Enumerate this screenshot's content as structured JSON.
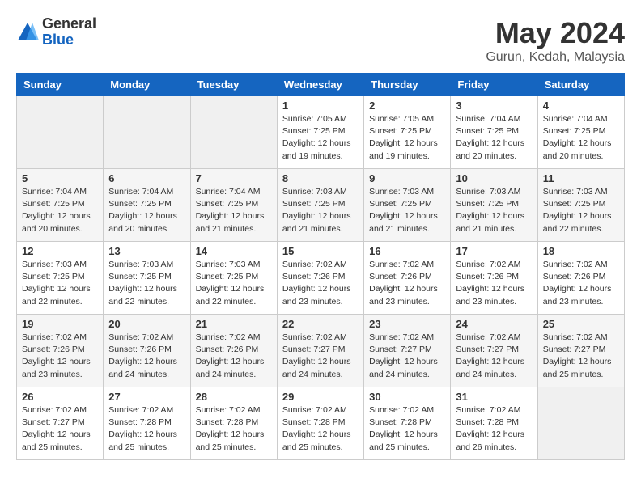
{
  "header": {
    "logo_general": "General",
    "logo_blue": "Blue",
    "month_title": "May 2024",
    "subtitle": "Gurun, Kedah, Malaysia"
  },
  "days_of_week": [
    "Sunday",
    "Monday",
    "Tuesday",
    "Wednesday",
    "Thursday",
    "Friday",
    "Saturday"
  ],
  "weeks": [
    [
      {
        "day": "",
        "info": ""
      },
      {
        "day": "",
        "info": ""
      },
      {
        "day": "",
        "info": ""
      },
      {
        "day": "1",
        "info": "Sunrise: 7:05 AM\nSunset: 7:25 PM\nDaylight: 12 hours\nand 19 minutes."
      },
      {
        "day": "2",
        "info": "Sunrise: 7:05 AM\nSunset: 7:25 PM\nDaylight: 12 hours\nand 19 minutes."
      },
      {
        "day": "3",
        "info": "Sunrise: 7:04 AM\nSunset: 7:25 PM\nDaylight: 12 hours\nand 20 minutes."
      },
      {
        "day": "4",
        "info": "Sunrise: 7:04 AM\nSunset: 7:25 PM\nDaylight: 12 hours\nand 20 minutes."
      }
    ],
    [
      {
        "day": "5",
        "info": "Sunrise: 7:04 AM\nSunset: 7:25 PM\nDaylight: 12 hours\nand 20 minutes."
      },
      {
        "day": "6",
        "info": "Sunrise: 7:04 AM\nSunset: 7:25 PM\nDaylight: 12 hours\nand 20 minutes."
      },
      {
        "day": "7",
        "info": "Sunrise: 7:04 AM\nSunset: 7:25 PM\nDaylight: 12 hours\nand 21 minutes."
      },
      {
        "day": "8",
        "info": "Sunrise: 7:03 AM\nSunset: 7:25 PM\nDaylight: 12 hours\nand 21 minutes."
      },
      {
        "day": "9",
        "info": "Sunrise: 7:03 AM\nSunset: 7:25 PM\nDaylight: 12 hours\nand 21 minutes."
      },
      {
        "day": "10",
        "info": "Sunrise: 7:03 AM\nSunset: 7:25 PM\nDaylight: 12 hours\nand 21 minutes."
      },
      {
        "day": "11",
        "info": "Sunrise: 7:03 AM\nSunset: 7:25 PM\nDaylight: 12 hours\nand 22 minutes."
      }
    ],
    [
      {
        "day": "12",
        "info": "Sunrise: 7:03 AM\nSunset: 7:25 PM\nDaylight: 12 hours\nand 22 minutes."
      },
      {
        "day": "13",
        "info": "Sunrise: 7:03 AM\nSunset: 7:25 PM\nDaylight: 12 hours\nand 22 minutes."
      },
      {
        "day": "14",
        "info": "Sunrise: 7:03 AM\nSunset: 7:25 PM\nDaylight: 12 hours\nand 22 minutes."
      },
      {
        "day": "15",
        "info": "Sunrise: 7:02 AM\nSunset: 7:26 PM\nDaylight: 12 hours\nand 23 minutes."
      },
      {
        "day": "16",
        "info": "Sunrise: 7:02 AM\nSunset: 7:26 PM\nDaylight: 12 hours\nand 23 minutes."
      },
      {
        "day": "17",
        "info": "Sunrise: 7:02 AM\nSunset: 7:26 PM\nDaylight: 12 hours\nand 23 minutes."
      },
      {
        "day": "18",
        "info": "Sunrise: 7:02 AM\nSunset: 7:26 PM\nDaylight: 12 hours\nand 23 minutes."
      }
    ],
    [
      {
        "day": "19",
        "info": "Sunrise: 7:02 AM\nSunset: 7:26 PM\nDaylight: 12 hours\nand 23 minutes."
      },
      {
        "day": "20",
        "info": "Sunrise: 7:02 AM\nSunset: 7:26 PM\nDaylight: 12 hours\nand 24 minutes."
      },
      {
        "day": "21",
        "info": "Sunrise: 7:02 AM\nSunset: 7:26 PM\nDaylight: 12 hours\nand 24 minutes."
      },
      {
        "day": "22",
        "info": "Sunrise: 7:02 AM\nSunset: 7:27 PM\nDaylight: 12 hours\nand 24 minutes."
      },
      {
        "day": "23",
        "info": "Sunrise: 7:02 AM\nSunset: 7:27 PM\nDaylight: 12 hours\nand 24 minutes."
      },
      {
        "day": "24",
        "info": "Sunrise: 7:02 AM\nSunset: 7:27 PM\nDaylight: 12 hours\nand 24 minutes."
      },
      {
        "day": "25",
        "info": "Sunrise: 7:02 AM\nSunset: 7:27 PM\nDaylight: 12 hours\nand 25 minutes."
      }
    ],
    [
      {
        "day": "26",
        "info": "Sunrise: 7:02 AM\nSunset: 7:27 PM\nDaylight: 12 hours\nand 25 minutes."
      },
      {
        "day": "27",
        "info": "Sunrise: 7:02 AM\nSunset: 7:28 PM\nDaylight: 12 hours\nand 25 minutes."
      },
      {
        "day": "28",
        "info": "Sunrise: 7:02 AM\nSunset: 7:28 PM\nDaylight: 12 hours\nand 25 minutes."
      },
      {
        "day": "29",
        "info": "Sunrise: 7:02 AM\nSunset: 7:28 PM\nDaylight: 12 hours\nand 25 minutes."
      },
      {
        "day": "30",
        "info": "Sunrise: 7:02 AM\nSunset: 7:28 PM\nDaylight: 12 hours\nand 25 minutes."
      },
      {
        "day": "31",
        "info": "Sunrise: 7:02 AM\nSunset: 7:28 PM\nDaylight: 12 hours\nand 26 minutes."
      },
      {
        "day": "",
        "info": ""
      }
    ]
  ]
}
